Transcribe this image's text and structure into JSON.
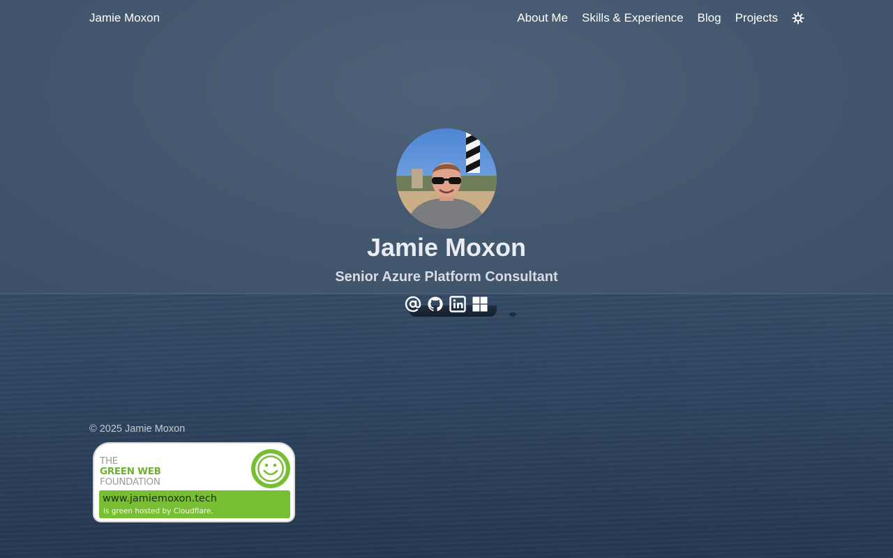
{
  "nav": {
    "brand": "Jamie Moxon",
    "items": [
      {
        "label": "About Me"
      },
      {
        "label": "Skills & Experience"
      },
      {
        "label": "Blog"
      },
      {
        "label": "Projects"
      }
    ],
    "theme_toggle_icon": "sun-icon"
  },
  "hero": {
    "name": "Jamie Moxon",
    "role": "Senior Azure Platform Consultant",
    "social": [
      {
        "icon": "at-email-icon"
      },
      {
        "icon": "github-icon"
      },
      {
        "icon": "linkedin-icon"
      },
      {
        "icon": "windows-icon"
      }
    ]
  },
  "footer": {
    "copyright": "© 2025 Jamie Moxon"
  },
  "badge": {
    "line1": "THE",
    "line2": "GREEN WEB",
    "line3": "FOUNDATION",
    "domain": "www.jamiemoxon.tech",
    "hosted": "is green hosted by Cloudflare.",
    "green": "#78be33"
  }
}
